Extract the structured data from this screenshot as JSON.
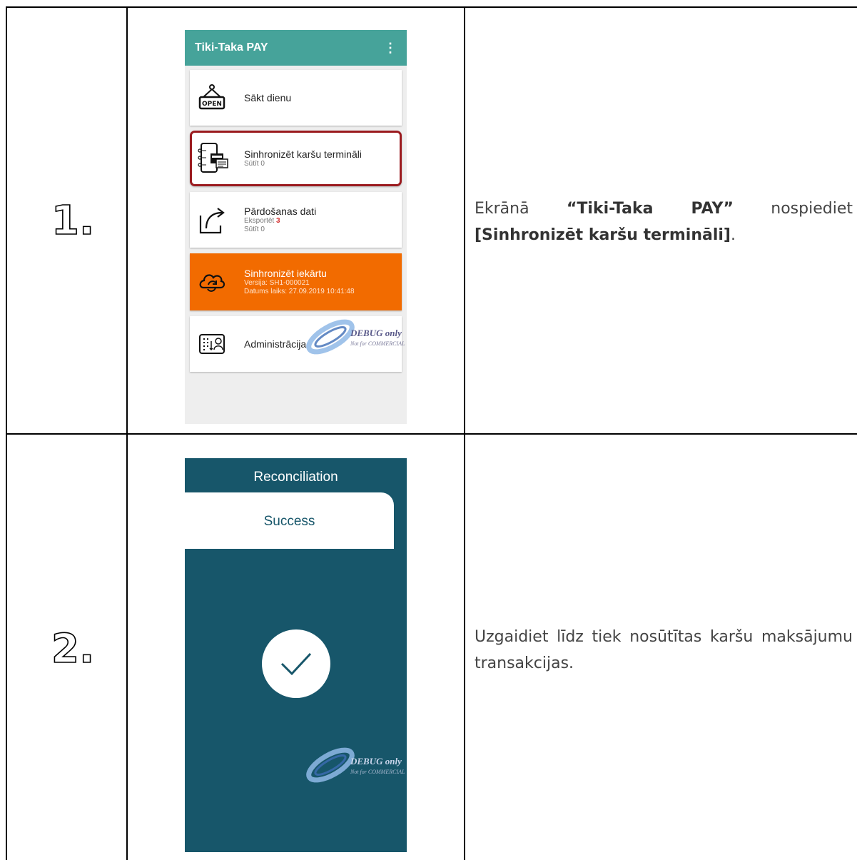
{
  "rows": [
    {
      "number": "1.",
      "description_parts": [
        "Ekrānā ",
        "“Tiki-Taka PAY”",
        " nospiediet ",
        "[Sinhronizēt karšu termināli]",
        "."
      ]
    },
    {
      "number": "2.",
      "description": "Uzgaidiet līdz tiek nosūtītas karšu maksājumu transakcijas."
    }
  ],
  "screen1": {
    "app_title": "Tiki-Taka PAY",
    "menu_icon": "kebab-menu-icon",
    "items": [
      {
        "title": "Sākt dienu",
        "icon": "open-sign-icon"
      },
      {
        "title": "Sinhronizēt karšu termināli",
        "sub1": "Sūtīt 0",
        "icon": "card-terminal-sync-icon",
        "selected": true
      },
      {
        "title": "Pārdošanas dati",
        "sub1_label": "Eksportēt",
        "sub1_value": "3",
        "sub2": "Sūtīt 0",
        "icon": "export-icon"
      },
      {
        "title": "Sinhronizēt iekārtu",
        "sub1": "Versija: SH1-000021",
        "sub2": "Datums laiks: 27.09.2019 10:41:48",
        "icon": "cloud-sync-icon",
        "highlight_color": "#f26b00"
      },
      {
        "title": "Administrācija",
        "icon": "admin-panel-icon"
      }
    ],
    "watermark_line1": "DEBUG only",
    "watermark_line2": "Not for COMMERCIAL"
  },
  "screen2": {
    "title": "Reconciliation",
    "status": "Success",
    "icon": "checkmark-icon",
    "watermark_line1": "DEBUG only",
    "watermark_line2": "Not for COMMERCIAL",
    "bg_color": "#17566a"
  }
}
